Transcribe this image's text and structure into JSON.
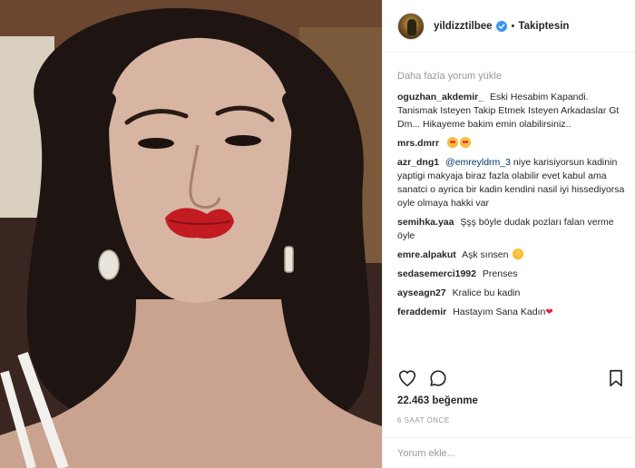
{
  "post": {
    "username": "yildizztilbee",
    "follow_status": "Takiptesin",
    "separator": "•",
    "likes_count": "22.463",
    "likes_label": "beğenme",
    "time_ago": "6 SAAT ÖNCE"
  },
  "comments_section": {
    "load_more": "Daha fazla yorum yükle",
    "items": [
      {
        "user": "oguzhan_akdemir_",
        "text": "Eski Hesabim Kapandi. Tanismak Isteyen Takip Etmek Isteyen Arkadaslar Gt Dm... Hikayeme bakim emin olabilirsiniz..",
        "mention": ""
      },
      {
        "user": "mrs.dmrr",
        "text": "",
        "mention": ""
      },
      {
        "user": "azr_dng1",
        "mention": "@emreyldrm_3",
        "text": "niye karisiyorsun kadinin yaptigi makyaja biraz fazla olabilir evet kabul ama sanatci o ayrica bir kadin kendini nasil iyi hissediyorsa oyle olmaya hakki var"
      },
      {
        "user": "semihka.yaa",
        "text": "Şşş böyle dudak pozları falan verme öyle",
        "mention": ""
      },
      {
        "user": "emre.alpakut",
        "text": "Aşk sınsen",
        "mention": ""
      },
      {
        "user": "sedasemerci1992",
        "text": "Prenses",
        "mention": ""
      },
      {
        "user": "ayseagn27",
        "text": "Kralice bu kadin",
        "mention": ""
      },
      {
        "user": "feraddemir",
        "text": "Hastayım Sana Kadın",
        "mention": ""
      }
    ]
  },
  "composer": {
    "placeholder": "Yorum ekle..."
  },
  "colors": {
    "verified": "#3897f0",
    "text": "#262626",
    "muted": "#999999",
    "border": "#efefef"
  },
  "icons": [
    "verified-badge-icon",
    "heart-icon",
    "comment-icon",
    "bookmark-icon"
  ]
}
